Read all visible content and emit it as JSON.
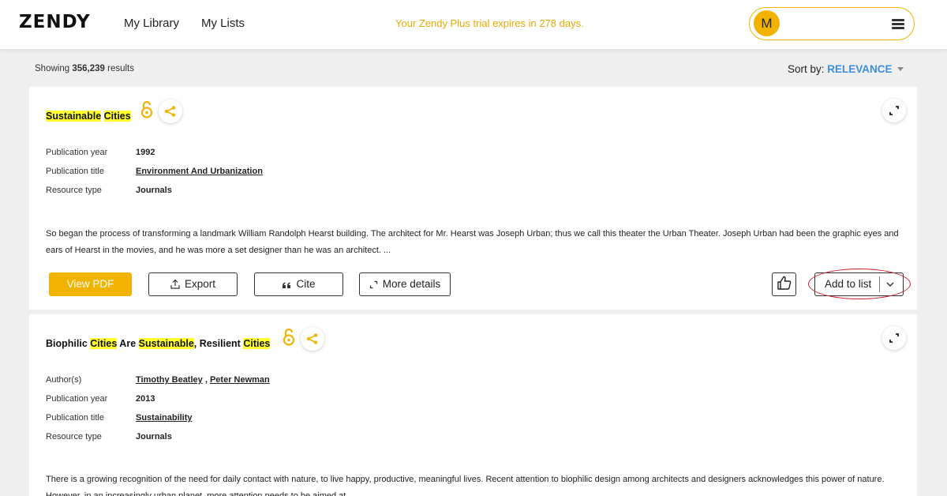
{
  "header": {
    "logo": "ZENDY",
    "nav": [
      "My Library",
      "My Lists"
    ],
    "trial_notice": "Your Zendy Plus trial expires in 278 days.",
    "avatar_initial": "M"
  },
  "results": {
    "showing_prefix": "Showing",
    "count": "356,239",
    "showing_suffix": "results",
    "sort_label": "Sort by:",
    "sort_value": "RELEVANCE"
  },
  "cards": [
    {
      "title_parts": [
        "Sustainable",
        "Cities"
      ],
      "meta": [
        {
          "label": "Publication year",
          "value": "1992"
        },
        {
          "label": "Publication title",
          "value": "Environment And Urbanization"
        },
        {
          "label": "Resource type",
          "value": "Journals"
        }
      ],
      "abstract": "So began the process of transforming a landmark William Randolph Hearst building. The architect for Mr. Hearst was Joseph Urban; thus we call this theater the Urban Theater. Joseph Urban had been the graphic eyes and ears of Hearst in the movies, and he was more a set designer than he was an architect. ...",
      "actions": {
        "view_pdf": "View PDF",
        "export": "Export",
        "cite": "Cite",
        "more_details": "More details",
        "add_to_list": "Add to list"
      }
    },
    {
      "title_parts": [
        "Biophilic ",
        "Cities",
        " Are ",
        "Sustainable",
        ", Resilient ",
        "Cities"
      ],
      "meta": [
        {
          "label": "Author(s)",
          "authors": [
            "Timothy Beatley",
            "Peter Newman"
          ],
          "separator": " , "
        },
        {
          "label": "Publication year",
          "value": "2013"
        },
        {
          "label": "Publication title",
          "value": "Sustainability"
        },
        {
          "label": "Resource type",
          "value": "Journals"
        }
      ],
      "abstract": "There is a growing recognition of the need for daily contact with nature, to live happy, productive, meaningful lives. Recent attention to biophilic design among architects and designers acknowledges this power of nature. However, in an increasingly urban planet, more attention needs to be aimed at"
    }
  ],
  "colors": {
    "accent": "#f2b300",
    "trial_text": "#e8a800",
    "sort_value": "#3b8ee0",
    "highlight": "#ffff2e",
    "annotation_ring": "#c8202a"
  },
  "icons": [
    "open-access-icon",
    "share-icon",
    "expand-icon",
    "upload-icon",
    "quote-icon",
    "expand-arrows-icon",
    "thumbs-up-icon",
    "chevron-down-icon",
    "menu-icon"
  ]
}
